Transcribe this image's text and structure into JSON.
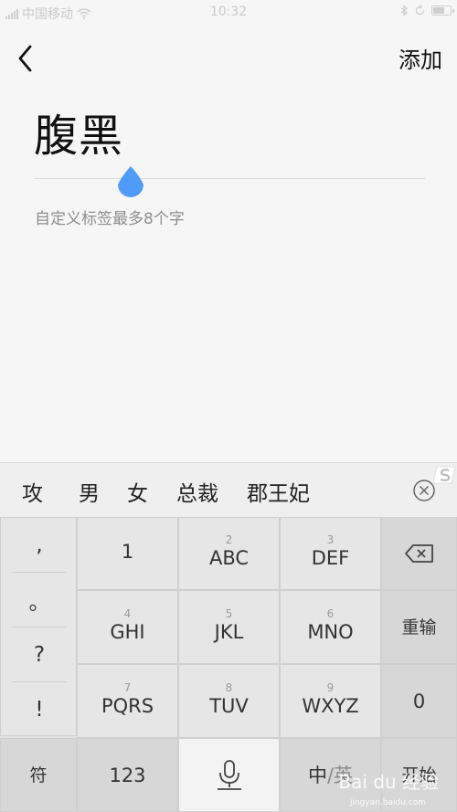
{
  "status_bar": {
    "carrier": "中国移动",
    "time": "10:32"
  },
  "nav": {
    "add_label": "添加"
  },
  "label_input": {
    "value": "腹黑",
    "hint": "自定义标签最多8个字"
  },
  "candidates": [
    "攻",
    "男",
    "女",
    "总裁",
    "郡王妃"
  ],
  "punctuation": [
    ",",
    "。",
    "?",
    "!"
  ],
  "keys": {
    "row1": [
      {
        "num": "",
        "label": "1"
      },
      {
        "num": "2",
        "label": "ABC"
      },
      {
        "num": "3",
        "label": "DEF"
      }
    ],
    "row2": [
      {
        "num": "4",
        "label": "GHI"
      },
      {
        "num": "5",
        "label": "JKL"
      },
      {
        "num": "6",
        "label": "MNO"
      }
    ],
    "row3": [
      {
        "num": "7",
        "label": "PQRS"
      },
      {
        "num": "8",
        "label": "TUV"
      },
      {
        "num": "9",
        "label": "WXYZ"
      }
    ],
    "retype": "重输",
    "zero": "0",
    "symbols": "符",
    "numbers": "123",
    "lang_zh": "中",
    "lang_sep": "/",
    "lang_en": "英",
    "start": "开始"
  },
  "watermark": {
    "text": "Bai du 经验",
    "sub": "jingyan.baidu.com"
  },
  "colors": {
    "accent": "#4f9bf7",
    "background": "#f6f6f6",
    "keyboard": "#e3e3e3"
  }
}
